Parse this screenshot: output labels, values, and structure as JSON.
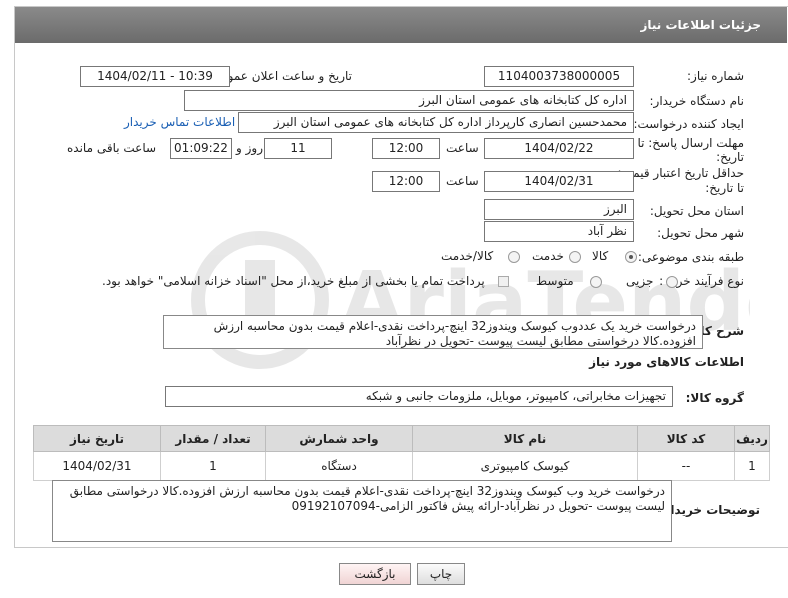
{
  "header": {
    "title": "جزئیات اطلاعات نیاز"
  },
  "fields": {
    "need_number_label": "شماره نیاز:",
    "need_number": "1104003738000005",
    "announce_label": "تاریخ و ساعت اعلان عمومی:",
    "announce_value": "1404/02/11 - 10:39",
    "buyer_org_label": "نام دستگاه خریدار:",
    "buyer_org": "اداره کل کتابخانه های عمومی استان البرز",
    "creator_label": "ایجاد کننده درخواست:",
    "creator": "محمدحسین انصاری کارپرداز اداره کل کتابخانه های عمومی استان البرز",
    "contact_link": "اطلاعات تماس خریدار",
    "deadline_label_1": "مهلت ارسال پاسخ: تا",
    "deadline_label_2": "تاریخ:",
    "deadline_date": "1404/02/22",
    "time_label": "ساعت",
    "deadline_time": "12:00",
    "days_value": "11",
    "days_label": "روز و",
    "remaining_time": "01:09:22",
    "remaining_label": "ساعت باقی مانده",
    "validity_label_1": "حداقل تاریخ اعتبار قیمت:",
    "validity_label_2": "تا تاریخ:",
    "validity_date": "1404/02/31",
    "validity_time_label": "ساعت",
    "validity_time": "12:00",
    "province_label": "استان محل تحویل:",
    "province": "البرز",
    "city_label": "شهر محل تحویل:",
    "city": "نظر آباد",
    "category_label": "طبقه بندی موضوعی:",
    "category_options": [
      "کالا",
      "خدمت",
      "کالا/خدمت"
    ],
    "process_label": "نوع فرآیند خرید :",
    "process_options": [
      "جزیی",
      "متوسط"
    ],
    "payment_note": "پرداخت تمام یا بخشی از مبلغ خرید،از محل \"اسناد خزانه اسلامی\" خواهد بود."
  },
  "description": {
    "label": "شرح کلی نیاز:",
    "text": "درخواست خرید یک عددوب کیوسک  ویندوز32 اینچ-پرداخت نقدی-اعلام قیمت بدون محاسبه ارزش افزوده.کالا درخواستی مطابق لیست پیوست -تحویل در نظرآباد"
  },
  "goods": {
    "section_title": "اطلاعات کالاهای مورد نیاز",
    "group_label": "گروه کالا:",
    "group_value": "تجهیزات مخابراتی، کامپیوتر، موبایل، ملزومات جانبی و شبکه",
    "table": {
      "headers": [
        "ردیف",
        "کد کالا",
        "نام کالا",
        "واحد شمارش",
        "تعداد / مقدار",
        "تاریخ نیاز"
      ],
      "rows": [
        [
          "1",
          "--",
          "کیوسک کامپیوتری",
          "دستگاه",
          "1",
          "1404/02/31"
        ]
      ]
    }
  },
  "buyer_notes": {
    "label": "توضیحات خریدار:",
    "text": "درخواست خرید وب کیوسک ویندوز32  اینچ-پرداخت نقدی-اعلام قیمت بدون محاسبه ارزش افزوده.کالا درخواستی مطابق لیست پیوست -تحویل در نظرآباد-ارائه پیش فاکتور الزامی-09192107094"
  },
  "buttons": {
    "print": "چاپ",
    "back": "بازگشت"
  },
  "watermark": {
    "brand": "AriaTender.net"
  }
}
